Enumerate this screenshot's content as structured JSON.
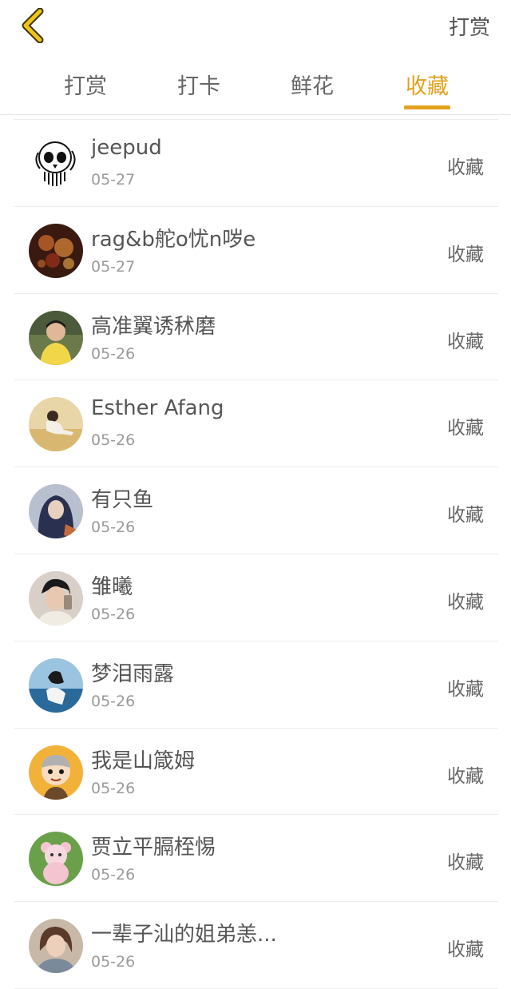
{
  "header": {
    "action_label": "打赏"
  },
  "tabs": [
    {
      "label": "打赏",
      "active": false
    },
    {
      "label": "打卡",
      "active": false
    },
    {
      "label": "鲜花",
      "active": false
    },
    {
      "label": "收藏",
      "active": true
    }
  ],
  "accent_color": "#e2a21f",
  "entries": [
    {
      "name": "jeepud",
      "date": "05-27",
      "action": "收藏",
      "avatar": "skull-sketch"
    },
    {
      "name": "rag&b舵o忧n哕e",
      "date": "05-27",
      "action": "收藏",
      "avatar": "warm-lights"
    },
    {
      "name": "高准翼诱秫磨",
      "date": "05-26",
      "action": "收藏",
      "avatar": "boy-yellow-shirt"
    },
    {
      "name": "Esther Afang",
      "date": "05-26",
      "action": "收藏",
      "avatar": "girl-on-sand"
    },
    {
      "name": "有只鱼",
      "date": "05-26",
      "action": "收藏",
      "avatar": "anime-girl-dark"
    },
    {
      "name": "雏曦",
      "date": "05-26",
      "action": "收藏",
      "avatar": "boy-with-phone"
    },
    {
      "name": "梦泪雨露",
      "date": "05-26",
      "action": "收藏",
      "avatar": "girl-by-sea"
    },
    {
      "name": "我是山箴姆",
      "date": "05-26",
      "action": "收藏",
      "avatar": "cartoon-boy"
    },
    {
      "name": "贾立平膈桎惕",
      "date": "05-26",
      "action": "收藏",
      "avatar": "pink-bear-toy"
    },
    {
      "name": "一辈子汕的姐弟恙...",
      "date": "05-26",
      "action": "收藏",
      "avatar": "girl-portrait"
    }
  ]
}
